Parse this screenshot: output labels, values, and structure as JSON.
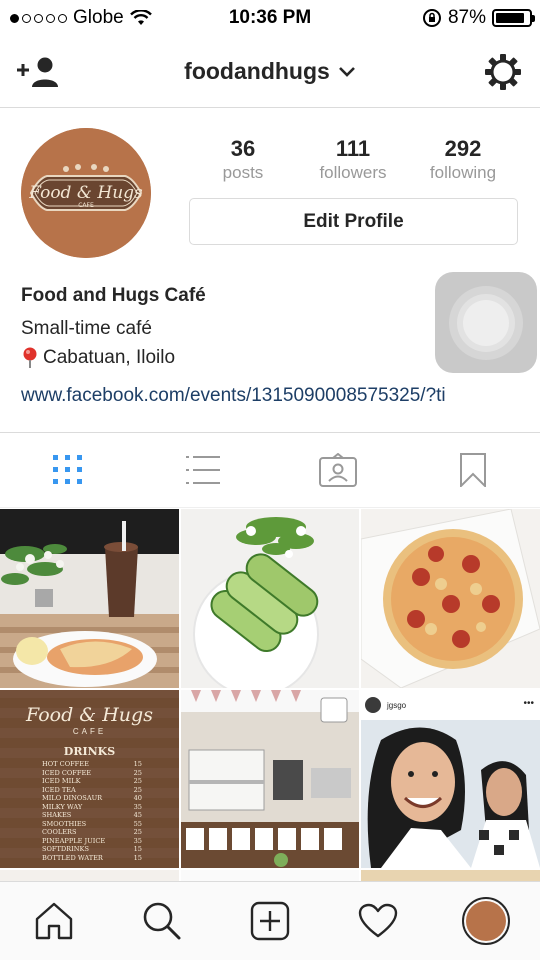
{
  "status_bar": {
    "carrier": "Globe",
    "time": "10:36 PM",
    "battery": "87%",
    "battery_level": 0.87
  },
  "header": {
    "username": "foodandhugs"
  },
  "profile": {
    "avatar_brand": "Food & Hugs",
    "avatar_sub": "CAFE",
    "stats": [
      {
        "value": "36",
        "label": "posts"
      },
      {
        "value": "111",
        "label": "followers"
      },
      {
        "value": "292",
        "label": "following"
      }
    ],
    "edit_button": "Edit Profile",
    "name": "Food and Hugs Café",
    "bio_line1": "Small-time café",
    "bio_location": "Cabatuan, Iloilo",
    "link": "www.facebook.com/events/1315090008575325/?ti"
  },
  "grid": {
    "menu_card": {
      "brand": "Food & Hugs",
      "sub": "CAFE",
      "heading": "DRINKS",
      "items": [
        "HOT COFFEE",
        "ICED COFFEE",
        "ICED MILK",
        "ICED TEA",
        "MILO DINOSAUR",
        "MILKY WAY",
        "SHAKES",
        "SMOOTHIES",
        "COOLERS",
        "PINEAPPLE JUICE",
        "SOFTDRINKS",
        "BOTTLED WATER"
      ],
      "prices": [
        "15",
        "25",
        "25",
        "25",
        "40",
        "35",
        "45",
        "55",
        "25",
        "35",
        "15",
        "15"
      ]
    },
    "post_username": "jgsgo"
  },
  "colors": {
    "brand_brown": "#b7734a",
    "link_blue": "#1d3e66",
    "active_tab_blue": "#3897f0",
    "muted_gray": "#999999",
    "border_gray": "#dbdbdb"
  }
}
